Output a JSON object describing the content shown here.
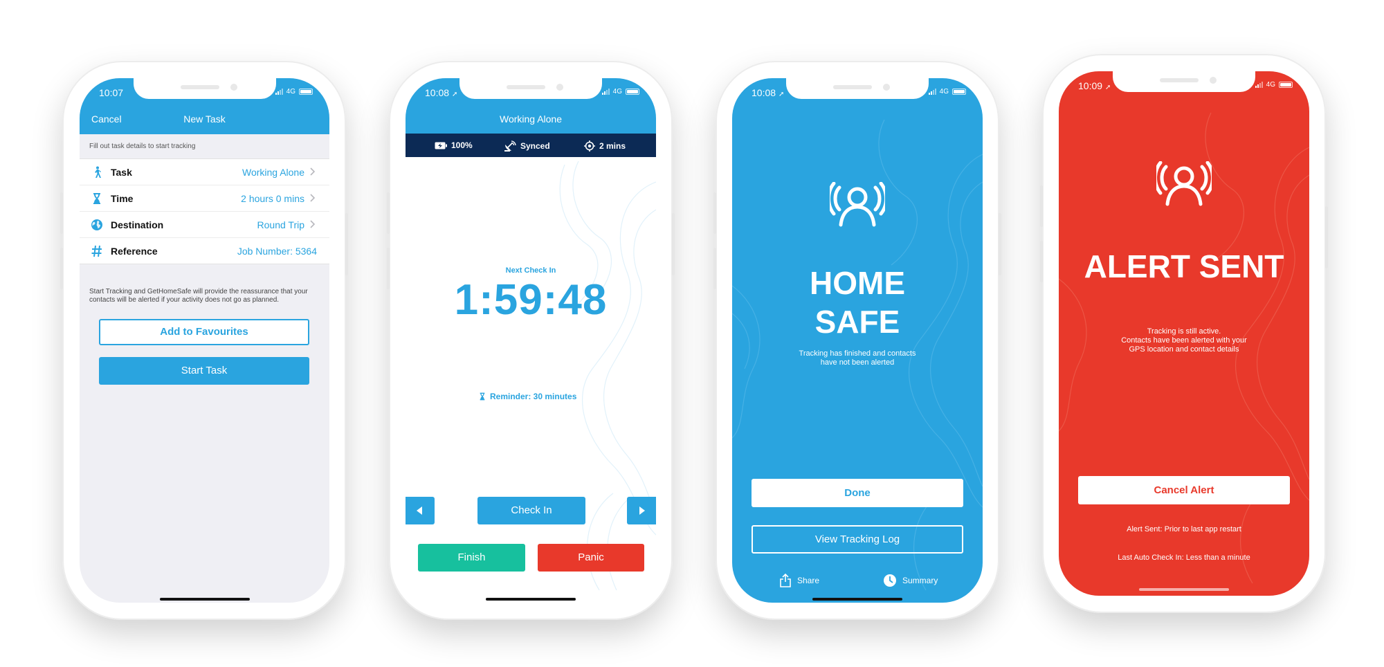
{
  "colors": {
    "primary_blue": "#2aa4df",
    "navy": "#0c2a55",
    "green": "#17c09e",
    "red": "#e8392b",
    "background": "#efeff4"
  },
  "screen1": {
    "status_time": "10:07",
    "network": "4G",
    "nav": {
      "cancel_label": "Cancel",
      "title": "New Task"
    },
    "hint": "Fill out task details to start tracking",
    "rows": [
      {
        "icon": "walking-person-icon",
        "label": "Task",
        "value": "Working Alone"
      },
      {
        "icon": "hourglass-icon",
        "label": "Time",
        "value": "2 hours 0 mins"
      },
      {
        "icon": "globe-icon",
        "label": "Destination",
        "value": "Round Trip"
      },
      {
        "icon": "hash-icon",
        "label": "Reference",
        "value": "Job Number: 5364"
      }
    ],
    "info": "Start Tracking and GetHomeSafe will provide the reassurance that your contacts will be alerted if your activity does not go as planned.",
    "favourites_label": "Add to Favourites",
    "start_label": "Start Task"
  },
  "screen2": {
    "status_time": "10:08",
    "network": "4G",
    "title": "Working Alone",
    "infobar": {
      "battery": "100%",
      "sync": "Synced",
      "gps": "2 mins"
    },
    "next_check_in_label": "Next Check In",
    "timer": "1:59:48",
    "reminder": "Reminder: 30 minutes",
    "check_in_label": "Check In",
    "finish_label": "Finish",
    "panic_label": "Panic"
  },
  "screen3": {
    "status_time": "10:08",
    "network": "4G",
    "headline_line1": "HOME",
    "headline_line2": "SAFE",
    "message_line1": "Tracking has finished and contacts",
    "message_line2": "have not been alerted",
    "done_label": "Done",
    "log_label": "View Tracking Log",
    "share_label": "Share",
    "summary_label": "Summary"
  },
  "screen4": {
    "status_time": "10:09",
    "network": "4G",
    "headline": "ALERT SENT",
    "message_line1": "Tracking is still active.",
    "message_line2": "Contacts have been alerted with your",
    "message_line3": "GPS location and contact details",
    "cancel_label": "Cancel Alert",
    "alert_sent_info": "Alert Sent: Prior to last app restart",
    "auto_check_in_info": "Last Auto Check In: Less than a minute"
  }
}
